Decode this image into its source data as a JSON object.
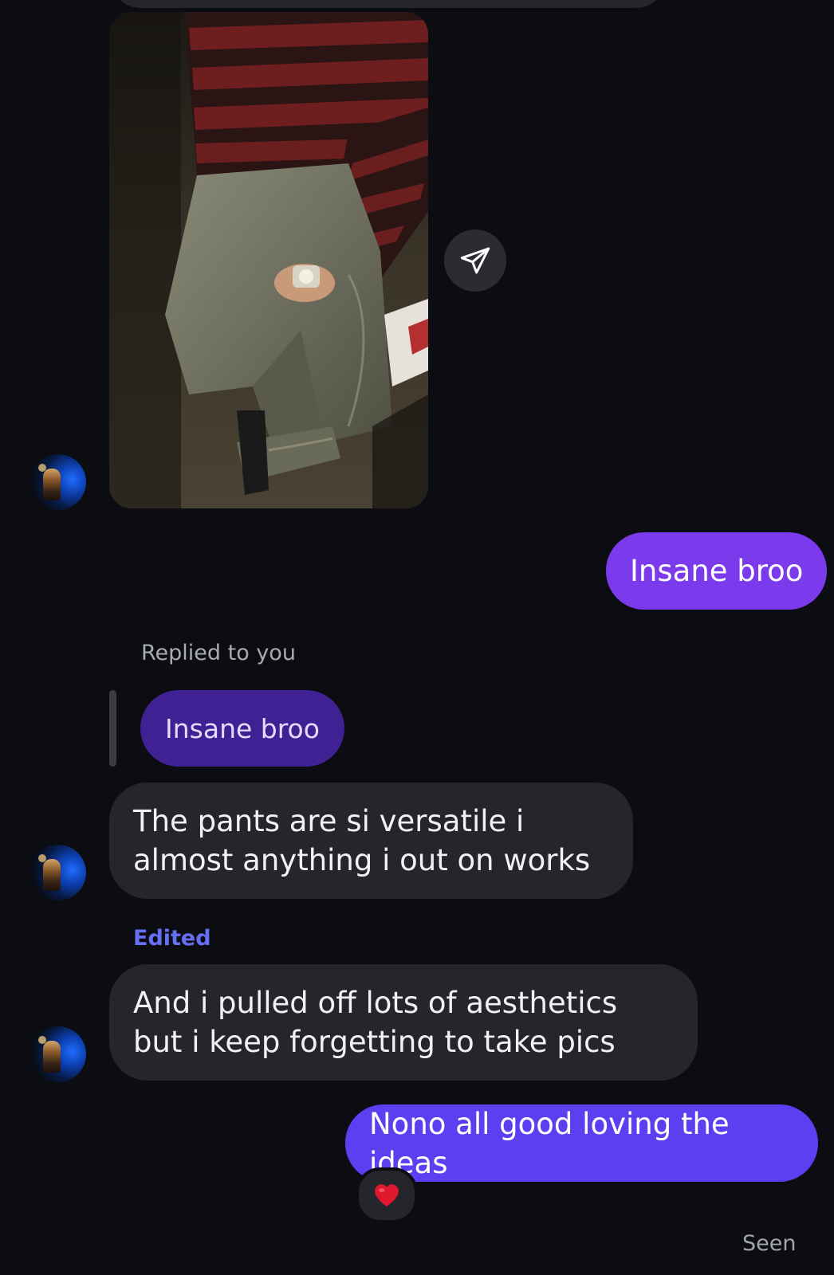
{
  "messages": {
    "photo_message": {
      "alt": "shared photo"
    },
    "sent_1": {
      "text": "Insane broo"
    },
    "reply": {
      "context_label": "Replied to you",
      "quoted_text": "Insane broo"
    },
    "received_1": {
      "text": "The pants are si versatile i almost anything i out on works"
    },
    "received_2": {
      "edited_label": "Edited",
      "text": "And i pulled off lots of aesthetics but i keep forgetting to take pics"
    },
    "sent_2": {
      "text": "Nono all good loving the ideas",
      "reaction": "❤️"
    },
    "status": "Seen"
  },
  "icons": {
    "share": "send-paper-plane-icon",
    "reaction": "heart-icon"
  },
  "colors": {
    "background": "#0b0d12",
    "received_bubble": "#24262c",
    "sent_bubble_purple": "#7c3aed",
    "sent_bubble_indigo": "#5b3ff0",
    "reply_quote": "#3f2193",
    "edited_label": "#6670f6"
  }
}
